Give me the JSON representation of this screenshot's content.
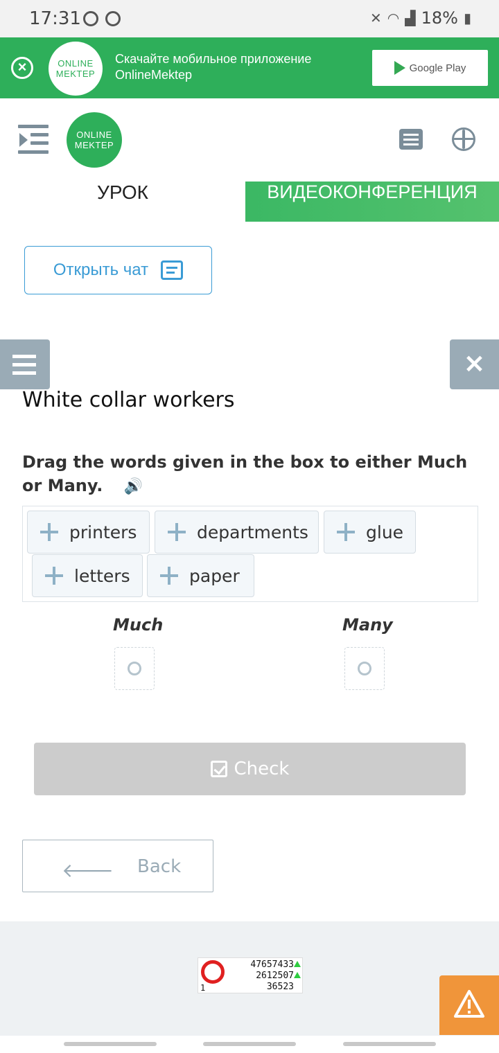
{
  "status_bar": {
    "time": "17:31",
    "battery": "18%",
    "icons": [
      "chrome-icon",
      "whatsapp-icon",
      "mute-icon",
      "wifi-icon",
      "signal-icon",
      "battery-icon"
    ]
  },
  "promo": {
    "logo_line1": "ONLINE",
    "logo_line2": "MEKTEP",
    "text": "Скачайте мобильное приложение OnlineMektep",
    "store_label": "Google Play"
  },
  "header": {
    "logo_line1": "ONLINE",
    "logo_line2": "MEKTEP"
  },
  "tabs": {
    "lesson": "УРОК",
    "video": "ВИДЕОКОНФЕРЕНЦИЯ"
  },
  "chat": {
    "label": "Открыть чат"
  },
  "exercise": {
    "title": "White collar workers",
    "instruction": "Drag the words given in the box to either Much or Many.",
    "words": [
      "printers",
      "departments",
      "glue",
      "letters",
      "paper"
    ],
    "zones": [
      "Much",
      "Many"
    ],
    "check_label": "Check",
    "back_label": "Back"
  },
  "counter": {
    "line1": "47657433",
    "line2": "2612507",
    "line3": "36523",
    "corner": "1"
  },
  "colors": {
    "brand_green": "#2eaf5a",
    "link_blue": "#3a9bd5",
    "warning_orange": "#f0953a",
    "muted_slate": "#9aabb6"
  }
}
